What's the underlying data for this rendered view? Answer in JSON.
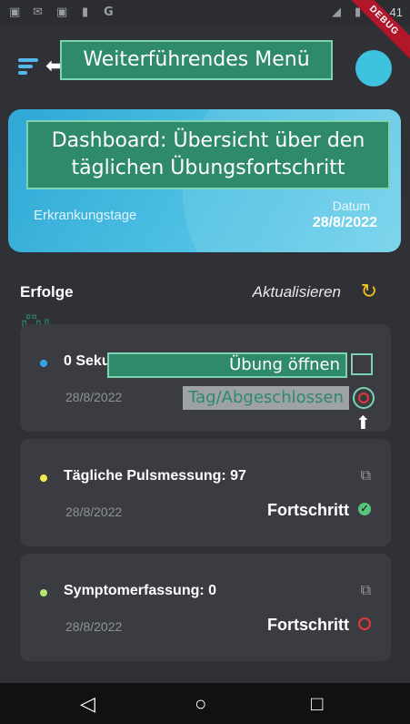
{
  "status_bar": {
    "icons": [
      "calendar-31-icon",
      "mail-icon",
      "calendar-31-icon",
      "sd-card-icon",
      "google-icon",
      "signal-icon",
      "battery-icon"
    ],
    "time": "41",
    "debug": "DEBUG"
  },
  "appbar": {
    "menu_annotation": "Weiterführendes Menü"
  },
  "dashboard": {
    "annotation": "Dashboard: Übersicht über den täglichen Übungsfortschritt",
    "illness_days_label": "Erkrankungstage",
    "date_label": "Datum",
    "date_value": "28/8/2022"
  },
  "section": {
    "title": "Erfolge",
    "refresh_label": "Aktualisieren",
    "exercises_annotation": "Übungen"
  },
  "cards": [
    {
      "title": "0 Seku",
      "date": "28/8/2022",
      "dot_color": "#2ea6ea",
      "progress": "",
      "status": "open"
    },
    {
      "title": "Tägliche Pulsmessung: 97",
      "date": "28/8/2022",
      "dot_color": "#f4e84a",
      "progress": "Fortschritt",
      "status": "done"
    },
    {
      "title": "Symptomerfassung: 0",
      "date": "28/8/2022",
      "dot_color": "#b3e86a",
      "progress": "Fortschritt",
      "status": "open"
    }
  ],
  "annotations": {
    "open_exercise": "Übung öffnen",
    "day_completed": "Tag/Abgeschlossen"
  },
  "nav": {
    "back": "◁",
    "home": "○",
    "recent": "□"
  }
}
